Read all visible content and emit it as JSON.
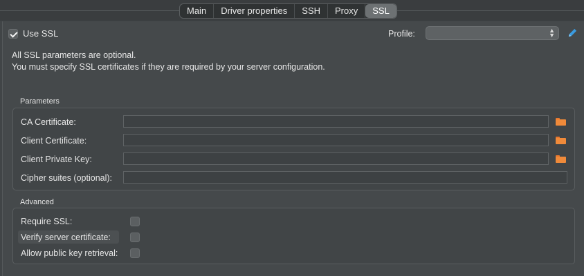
{
  "tabs": [
    {
      "label": "Main"
    },
    {
      "label": "Driver properties"
    },
    {
      "label": "SSH"
    },
    {
      "label": "Proxy"
    },
    {
      "label": "SSL",
      "active": true
    }
  ],
  "use_ssl": {
    "label": "Use SSL",
    "checked": true
  },
  "profile": {
    "label": "Profile:",
    "value": ""
  },
  "info": {
    "line1": "All SSL parameters are optional.",
    "line2": "You must specify SSL certificates if they are required by your server configuration."
  },
  "parameters": {
    "title": "Parameters",
    "fields": [
      {
        "label": "CA Certificate:",
        "value": ""
      },
      {
        "label": "Client Certificate:",
        "value": ""
      },
      {
        "label": "Client Private Key:",
        "value": ""
      },
      {
        "label": "Cipher suites (optional):",
        "value": ""
      }
    ]
  },
  "advanced": {
    "title": "Advanced",
    "options": [
      {
        "label": "Require SSL:",
        "checked": false
      },
      {
        "label": "Verify server certificate:",
        "checked": false
      },
      {
        "label": "Allow public key retrieval:",
        "checked": false
      }
    ]
  },
  "icons": {
    "folder_color": "#f08a3a",
    "pencil_color": "#3a9be0"
  }
}
